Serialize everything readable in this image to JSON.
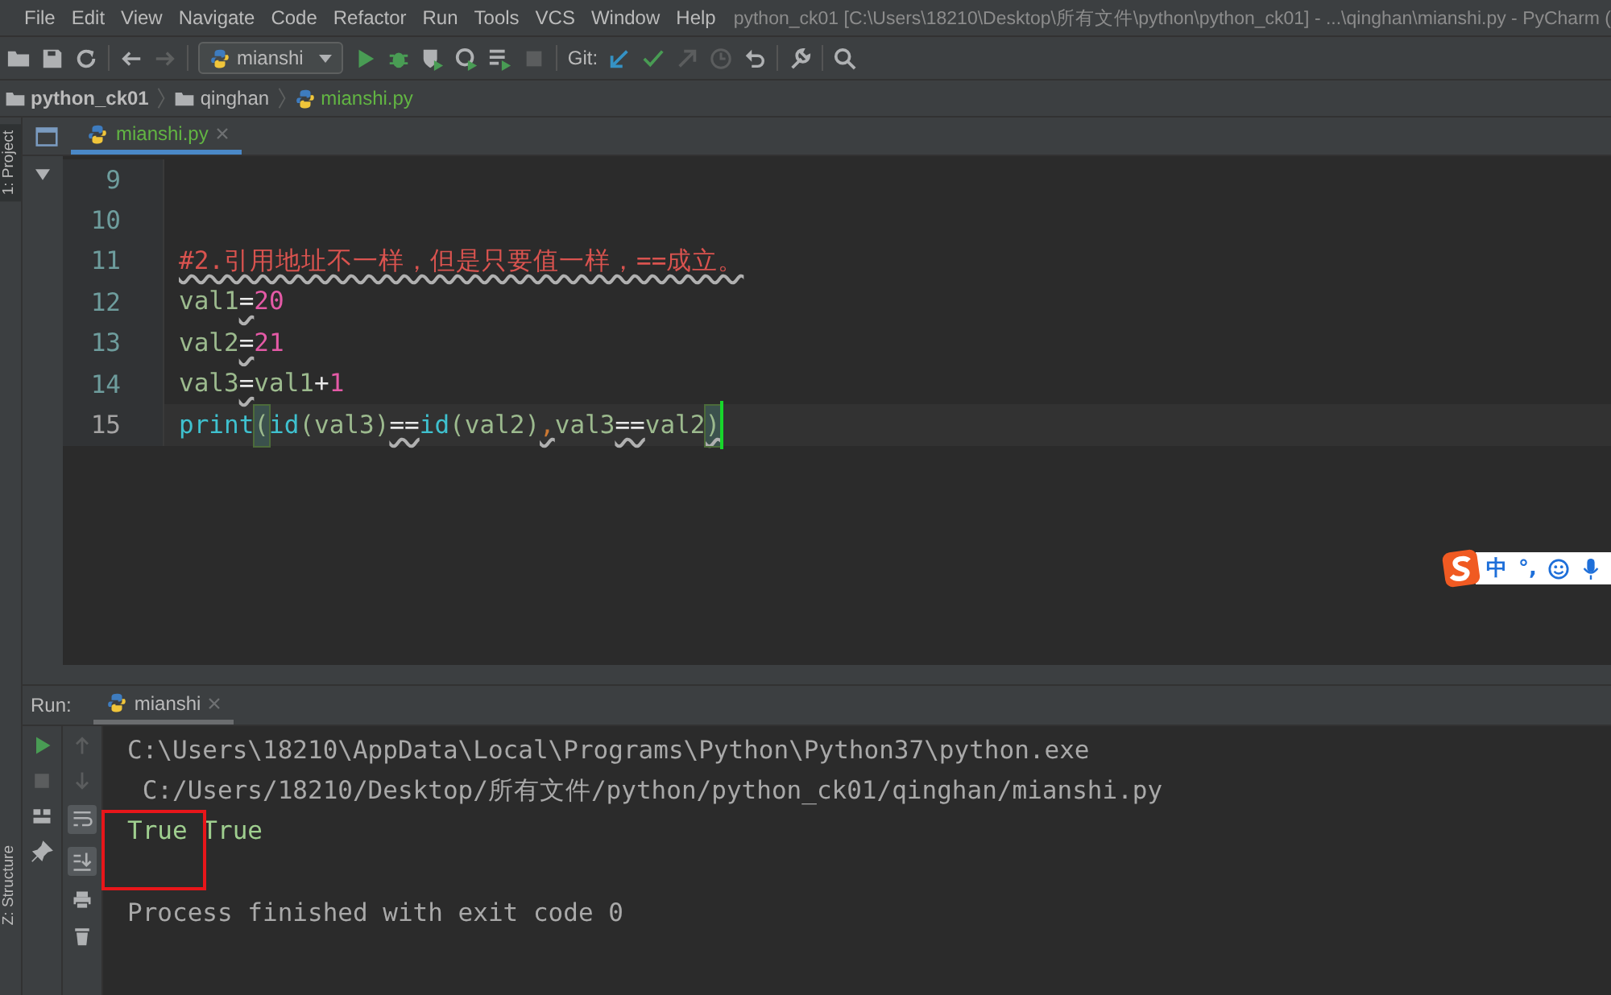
{
  "window": {
    "title": "python_ck01 [C:\\Users\\18210\\Desktop\\所有文件\\python\\python_ck01] - ...\\qinghan\\mianshi.py - PyCharm ("
  },
  "menu": [
    "File",
    "Edit",
    "View",
    "Navigate",
    "Code",
    "Refactor",
    "Run",
    "Tools",
    "VCS",
    "Window",
    "Help"
  ],
  "toolbar": {
    "run_config": "mianshi",
    "vcs_label": "Git:"
  },
  "breadcrumbs": [
    {
      "label": "python_ck01",
      "kind": "project"
    },
    {
      "label": "qinghan",
      "kind": "folder"
    },
    {
      "label": "mianshi.py",
      "kind": "file"
    }
  ],
  "side_panels": {
    "top": "1: Project",
    "bottom": "Z: Structure"
  },
  "editor_tabs": [
    {
      "label": "mianshi.py",
      "selected": true
    }
  ],
  "code_lines": [
    {
      "number": "9",
      "current": false
    },
    {
      "number": "10",
      "current": false
    },
    {
      "number": "11",
      "current": false,
      "tokens": [
        {
          "text": "#2.引用地址不一样，但是只要值一样，==成立。",
          "kind": "comment",
          "warned": true,
          "matched": false
        }
      ]
    },
    {
      "number": "12",
      "current": false,
      "tokens": [
        {
          "text": "val1",
          "kind": "name",
          "warned": false,
          "matched": false
        },
        {
          "text": "=",
          "kind": "op",
          "warned": true,
          "matched": false
        },
        {
          "text": "20",
          "kind": "num",
          "warned": false,
          "matched": false
        }
      ]
    },
    {
      "number": "13",
      "current": false,
      "tokens": [
        {
          "text": "val2",
          "kind": "name",
          "warned": false,
          "matched": false
        },
        {
          "text": "=",
          "kind": "op",
          "warned": true,
          "matched": false
        },
        {
          "text": "21",
          "kind": "num",
          "warned": false,
          "matched": false
        }
      ]
    },
    {
      "number": "14",
      "current": false,
      "tokens": [
        {
          "text": "val3",
          "kind": "name",
          "warned": false,
          "matched": false
        },
        {
          "text": "=",
          "kind": "op",
          "warned": true,
          "matched": false
        },
        {
          "text": "val1",
          "kind": "name",
          "warned": false,
          "matched": false
        },
        {
          "text": "+",
          "kind": "op",
          "warned": false,
          "matched": false
        },
        {
          "text": "1",
          "kind": "num",
          "warned": false,
          "matched": false
        }
      ]
    },
    {
      "number": "15",
      "current": true,
      "tokens": [
        {
          "text": "print",
          "kind": "builtin",
          "warned": false,
          "matched": false
        },
        {
          "text": "(",
          "kind": "name",
          "warned": false,
          "matched": true
        },
        {
          "text": "id",
          "kind": "builtin",
          "warned": false,
          "matched": false
        },
        {
          "text": "(val3)",
          "kind": "name",
          "warned": false,
          "matched": false
        },
        {
          "text": "==",
          "kind": "op",
          "warned": true,
          "matched": false
        },
        {
          "text": "id",
          "kind": "builtin",
          "warned": false,
          "matched": false
        },
        {
          "text": "(val2)",
          "kind": "name",
          "warned": false,
          "matched": false
        },
        {
          "text": ",",
          "kind": "punct",
          "warned": true,
          "matched": false
        },
        {
          "text": "val3",
          "kind": "name",
          "warned": false,
          "matched": false
        },
        {
          "text": "==",
          "kind": "op",
          "warned": true,
          "matched": false
        },
        {
          "text": "val2",
          "kind": "name",
          "warned": false,
          "matched": false
        },
        {
          "text": ")",
          "kind": "name",
          "warned": true,
          "matched": true
        }
      ]
    }
  ],
  "ime_toolbar": {
    "items": [
      "中",
      "°,"
    ]
  },
  "run_panel": {
    "label": "Run:",
    "tabs": [
      {
        "label": "mianshi",
        "selected": true
      }
    ],
    "soft_wrap": {
      "selected": true
    },
    "scroll_to_end": {
      "selected": true
    },
    "output": [
      {
        "text": "C:\\Users\\18210\\AppData\\Local\\Programs\\Python\\Python37\\python.exe",
        "kind": "command"
      },
      {
        "text": " C:/Users/18210/Desktop/所有文件/python/python_ck01/qinghan/mianshi.py",
        "kind": "command"
      },
      {
        "text": "True True",
        "kind": "result"
      },
      {
        "kind": "blank"
      },
      {
        "text": "Process finished with exit code 0",
        "kind": "command"
      }
    ]
  }
}
